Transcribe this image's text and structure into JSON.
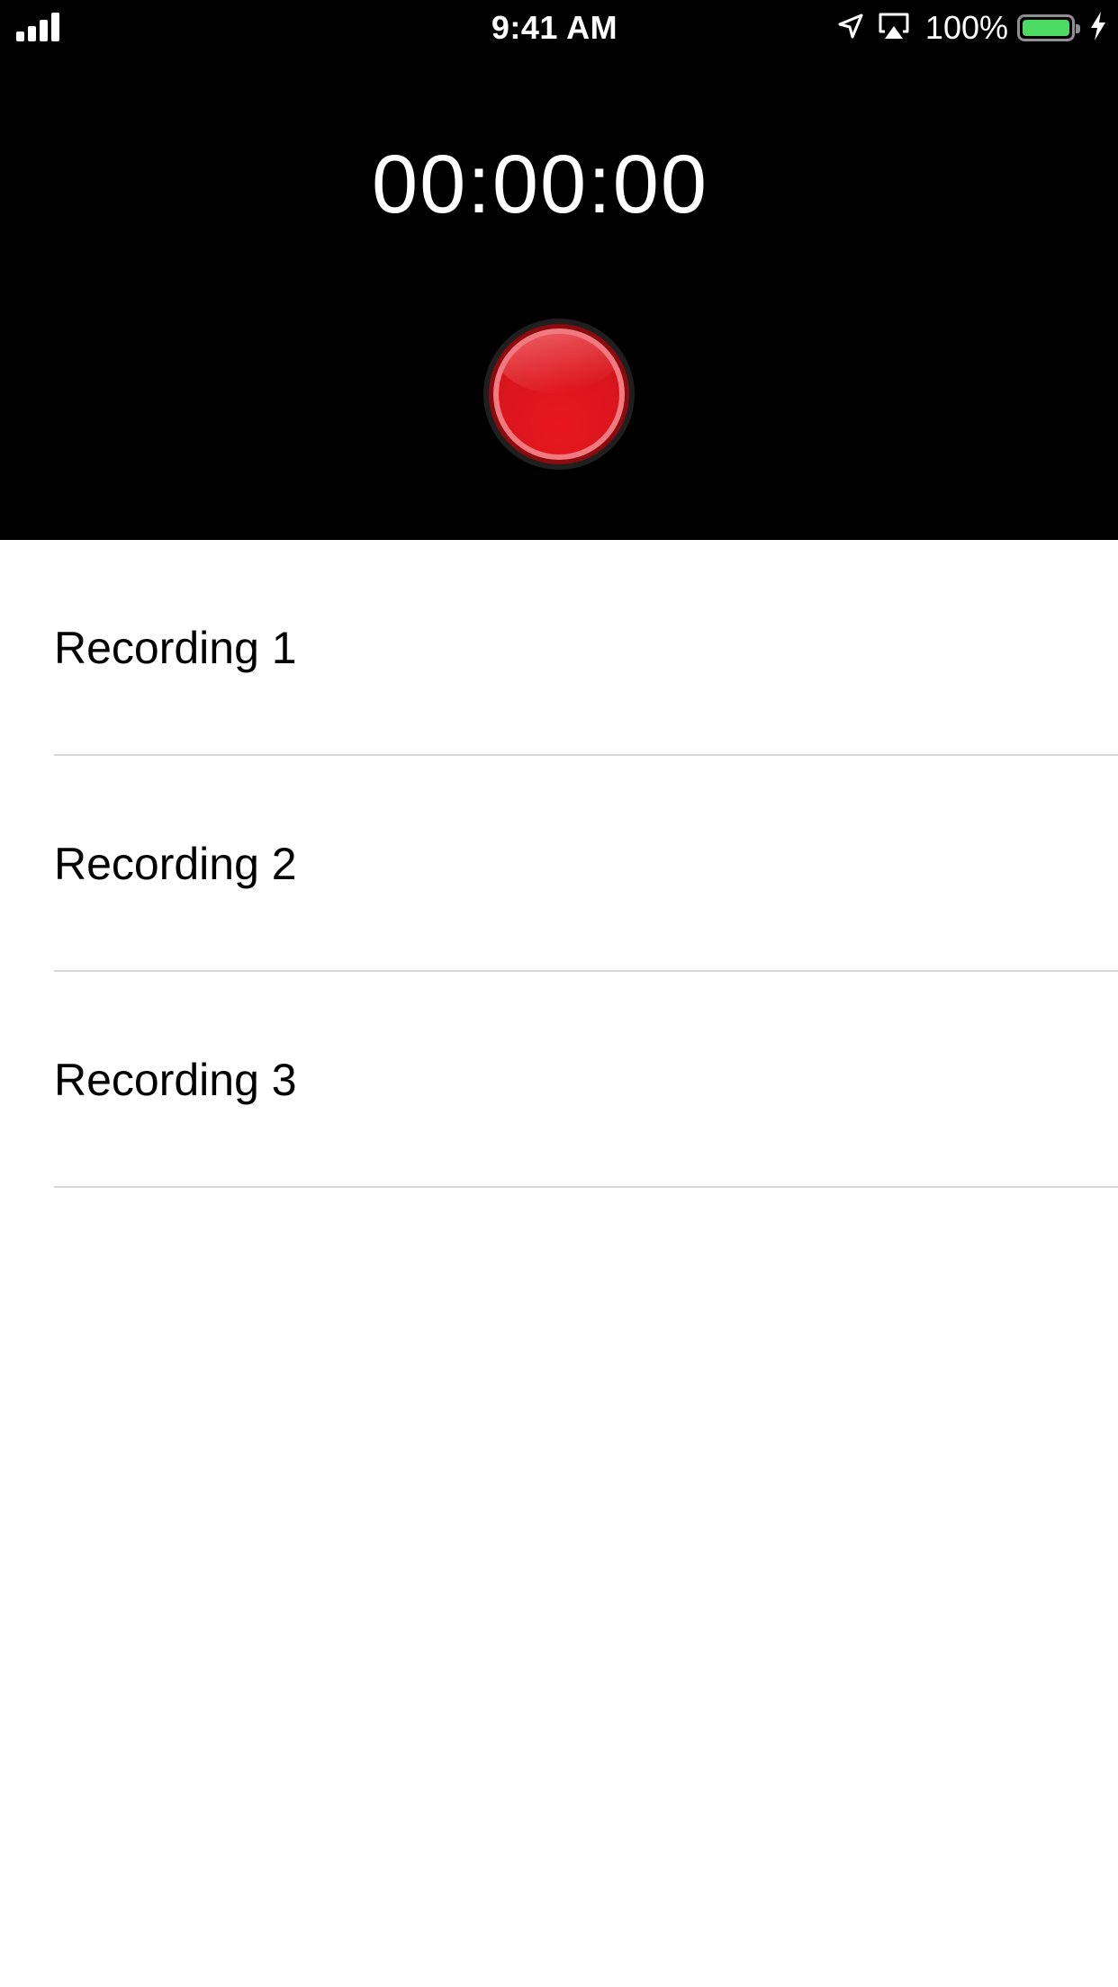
{
  "status_bar": {
    "time": "9:41 AM",
    "battery_percent": "100%",
    "icons": [
      "signal-icon",
      "location-arrow-icon",
      "airplay-icon",
      "battery-icon",
      "charging-bolt-icon"
    ],
    "battery_color": "#4cd964"
  },
  "recorder": {
    "timer": "00:00:00",
    "record_button_color": "#e3161e"
  },
  "recordings": [
    {
      "label": "Recording 1"
    },
    {
      "label": "Recording 2"
    },
    {
      "label": "Recording 3"
    }
  ]
}
